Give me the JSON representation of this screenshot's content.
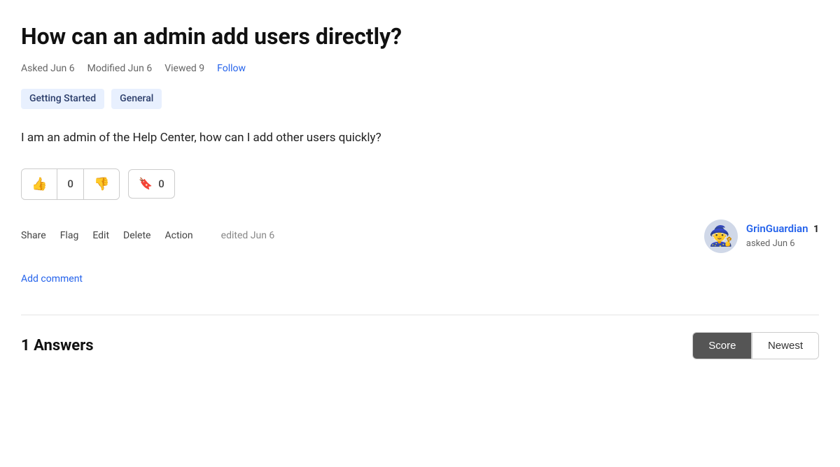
{
  "page": {
    "title": "How can an admin add users directly?"
  },
  "meta": {
    "asked": "Asked Jun 6",
    "modified": "Modified Jun 6",
    "viewed": "Viewed 9",
    "follow_label": "Follow"
  },
  "tags": [
    {
      "label": "Getting Started"
    },
    {
      "label": "General"
    }
  ],
  "question": {
    "body": "I am an admin of the Help Center, how can I add other users quickly?"
  },
  "votes": {
    "upvote_icon": "👍",
    "downvote_icon": "👎",
    "count": "0"
  },
  "bookmark": {
    "icon": "🔖",
    "count": "0"
  },
  "actions": {
    "share": "Share",
    "flag": "Flag",
    "edit": "Edit",
    "delete": "Delete",
    "action": "Action",
    "edited": "edited Jun 6"
  },
  "user": {
    "name": "GrinGuardian",
    "rep": "1",
    "asked": "asked Jun 6",
    "avatar_emoji": "🧙"
  },
  "comment": {
    "add_label": "Add comment"
  },
  "answers": {
    "count_label": "1 Answers",
    "sort_score": "Score",
    "sort_newest": "Newest"
  }
}
